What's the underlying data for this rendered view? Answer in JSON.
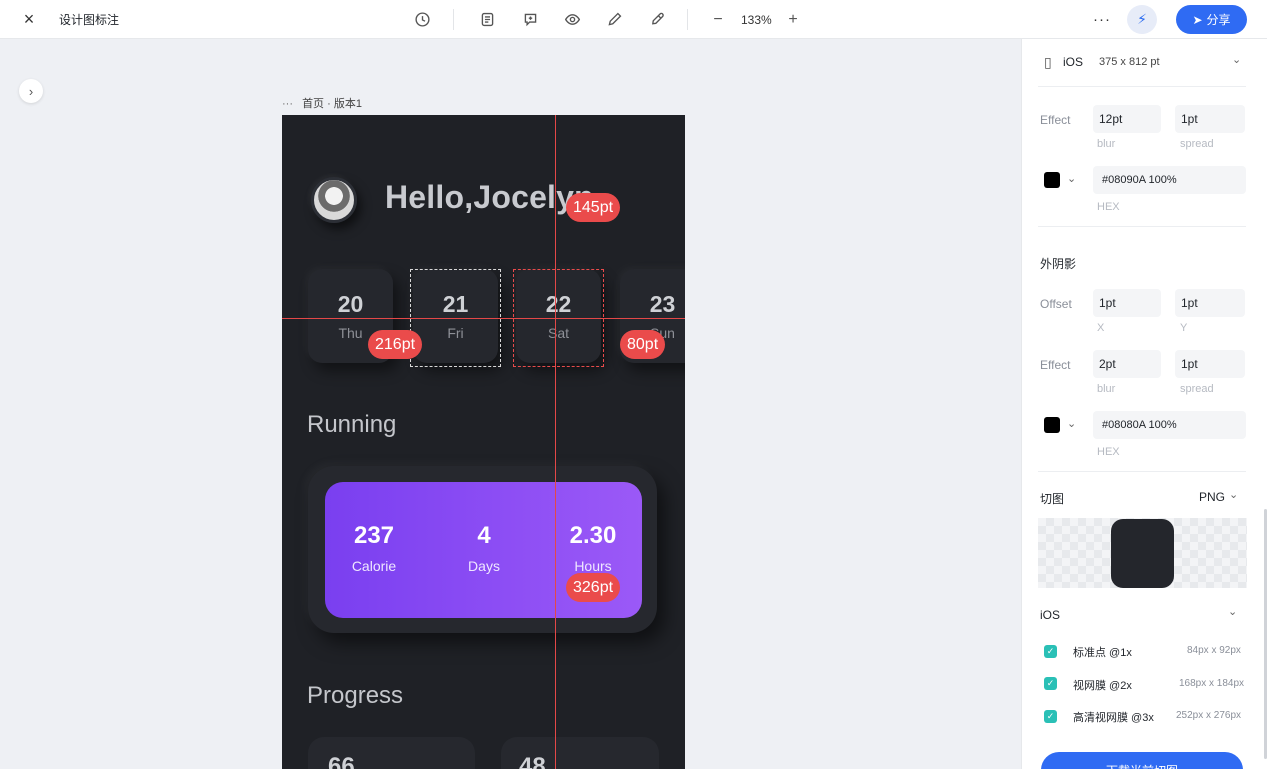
{
  "toolbar": {
    "close_icon": "×",
    "title": "设计图标注",
    "zoom": "133%",
    "zoom_minus": "−",
    "zoom_plus": "+",
    "more": "···",
    "flash_icon": "⚡",
    "share_icon": "➤",
    "share_label": "分享"
  },
  "canvas": {
    "expand_icon": "›",
    "frame_dots": "···",
    "frame_label": "首页 · 版本1"
  },
  "design": {
    "greeting": "Hello,Jocelyn",
    "days": [
      {
        "num": "20",
        "name": "Thu"
      },
      {
        "num": "21",
        "name": "Fri"
      },
      {
        "num": "22",
        "name": "Sat"
      },
      {
        "num": "23",
        "name": "Sun"
      }
    ],
    "running_title": "Running",
    "stats": [
      {
        "value": "237",
        "label": "Calorie"
      },
      {
        "value": "4",
        "label": "Days"
      },
      {
        "value": "2.30",
        "label": "Hours"
      }
    ],
    "progress_title": "Progress",
    "progress_nums": [
      "66",
      "48"
    ]
  },
  "measures": {
    "m145": "145pt",
    "m216": "216pt",
    "m80": "80pt",
    "m326": "326pt"
  },
  "panel": {
    "device_icon": "▯",
    "platform": "iOS",
    "size": "375 x 812 pt",
    "chevron": "⌄",
    "inner_effect": {
      "label": "Effect",
      "blur": "12pt",
      "blur_label": "blur",
      "spread": "1pt",
      "spread_label": "spread",
      "hex": "#08090A   100%",
      "hex_label": "HEX"
    },
    "outer_shadow_title": "外阴影",
    "offset": {
      "label": "Offset",
      "x": "1pt",
      "x_label": "X",
      "y": "1pt",
      "y_label": "Y"
    },
    "outer_effect": {
      "label": "Effect",
      "blur": "2pt",
      "blur_label": "blur",
      "spread": "1pt",
      "spread_label": "spread",
      "hex": "#08080A   100%",
      "hex_label": "HEX"
    },
    "slice_title": "切图",
    "slice_format": "PNG",
    "export_platform": "iOS",
    "exports": [
      {
        "name": "标准点 @1x",
        "size": "84px x 92px"
      },
      {
        "name": "视网膜 @2x",
        "size": "168px x 184px"
      },
      {
        "name": "高清视网膜 @3x",
        "size": "252px x 276px"
      }
    ],
    "download_label": "下载当前切图"
  },
  "colors": {
    "accent": "#2f6bf3",
    "measure_red": "#ea4b4b",
    "artboard_bg": "#1f2126",
    "running_gradient_start": "#7a3ff0",
    "running_gradient_end": "#9b59f7",
    "checkbox": "#2ac0b6"
  }
}
